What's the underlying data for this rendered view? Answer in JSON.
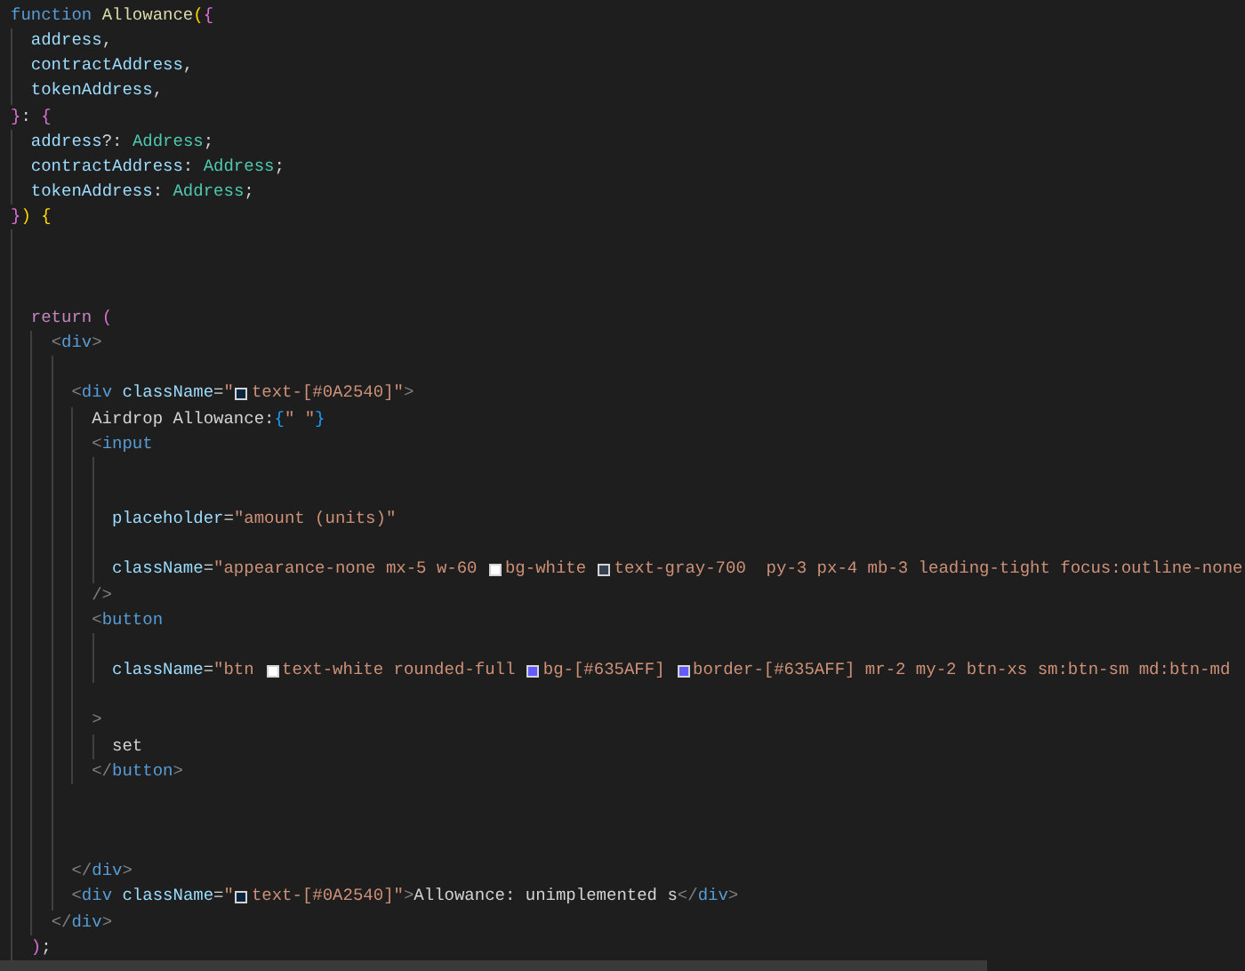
{
  "editor": {
    "lines": [
      {
        "kind": "code",
        "tokens": [
          {
            "kind": "storage",
            "text": "function "
          },
          {
            "kind": "func",
            "text": "Allowance"
          },
          {
            "kind": "b1",
            "text": "("
          },
          {
            "kind": "b2",
            "text": "{"
          }
        ]
      },
      {
        "kind": "code",
        "tokens": [
          {
            "kind": "var",
            "text": "  address"
          },
          {
            "kind": "punct",
            "text": ","
          }
        ]
      },
      {
        "kind": "code",
        "tokens": [
          {
            "kind": "var",
            "text": "  contractAddress"
          },
          {
            "kind": "punct",
            "text": ","
          }
        ]
      },
      {
        "kind": "code",
        "tokens": [
          {
            "kind": "var",
            "text": "  tokenAddress"
          },
          {
            "kind": "punct",
            "text": ","
          }
        ]
      },
      {
        "kind": "code",
        "tokens": [
          {
            "kind": "b2",
            "text": "}"
          },
          {
            "kind": "punct",
            "text": ": "
          },
          {
            "kind": "b2",
            "text": "{"
          }
        ]
      },
      {
        "kind": "code",
        "tokens": [
          {
            "kind": "var",
            "text": "  address"
          },
          {
            "kind": "punct",
            "text": "?: "
          },
          {
            "kind": "type",
            "text": "Address"
          },
          {
            "kind": "punct",
            "text": ";"
          }
        ]
      },
      {
        "kind": "code",
        "tokens": [
          {
            "kind": "var",
            "text": "  contractAddress"
          },
          {
            "kind": "punct",
            "text": ": "
          },
          {
            "kind": "type",
            "text": "Address"
          },
          {
            "kind": "punct",
            "text": ";"
          }
        ]
      },
      {
        "kind": "code",
        "tokens": [
          {
            "kind": "var",
            "text": "  tokenAddress"
          },
          {
            "kind": "punct",
            "text": ": "
          },
          {
            "kind": "type",
            "text": "Address"
          },
          {
            "kind": "punct",
            "text": ";"
          }
        ]
      },
      {
        "kind": "code",
        "tokens": [
          {
            "kind": "b2",
            "text": "}"
          },
          {
            "kind": "b1",
            "text": ")"
          },
          {
            "kind": "b1",
            "text": " {"
          }
        ]
      },
      {
        "kind": "blank"
      },
      {
        "kind": "blank"
      },
      {
        "kind": "blank"
      },
      {
        "kind": "code",
        "tokens": [
          {
            "kind": "control",
            "text": "  return "
          },
          {
            "kind": "b2",
            "text": "("
          }
        ]
      },
      {
        "kind": "code",
        "tokens": [
          {
            "kind": "tagpunct",
            "text": "    <"
          },
          {
            "kind": "tag",
            "text": "div"
          },
          {
            "kind": "tagpunct",
            "text": ">"
          }
        ]
      },
      {
        "kind": "blank"
      },
      {
        "kind": "code",
        "tokens": [
          {
            "kind": "tagpunct",
            "text": "      <"
          },
          {
            "kind": "tag",
            "text": "div"
          },
          {
            "kind": "attr",
            "text": " className"
          },
          {
            "kind": "punct",
            "text": "="
          },
          {
            "kind": "string",
            "text": "\""
          },
          {
            "kind": "swatch",
            "color": "#0a2540"
          },
          {
            "kind": "string",
            "text": "text-[#0A2540]\""
          },
          {
            "kind": "tagpunct",
            "text": ">"
          }
        ]
      },
      {
        "kind": "code",
        "tokens": [
          {
            "kind": "text",
            "text": "        Airdrop Allowance:"
          },
          {
            "kind": "b3",
            "text": "{"
          },
          {
            "kind": "string",
            "text": "\" \""
          },
          {
            "kind": "b3",
            "text": "}"
          }
        ]
      },
      {
        "kind": "code",
        "tokens": [
          {
            "kind": "tagpunct",
            "text": "        <"
          },
          {
            "kind": "tag",
            "text": "input"
          }
        ]
      },
      {
        "kind": "blank"
      },
      {
        "kind": "blank"
      },
      {
        "kind": "code",
        "tokens": [
          {
            "kind": "attr",
            "text": "          placeholder"
          },
          {
            "kind": "punct",
            "text": "="
          },
          {
            "kind": "string",
            "text": "\"amount (units)\""
          }
        ]
      },
      {
        "kind": "blank"
      },
      {
        "kind": "code",
        "tokens": [
          {
            "kind": "attr",
            "text": "          className"
          },
          {
            "kind": "punct",
            "text": "="
          },
          {
            "kind": "string",
            "text": "\"appearance-none mx-5 w-60 "
          },
          {
            "kind": "swatch",
            "color": "#ffffff"
          },
          {
            "kind": "string",
            "text": "bg-white "
          },
          {
            "kind": "swatch",
            "color": "#374151"
          },
          {
            "kind": "string",
            "text": "text-gray-700  py-3 px-4 mb-3 leading-tight focus:outline-none"
          }
        ]
      },
      {
        "kind": "code",
        "tokens": [
          {
            "kind": "tagpunct",
            "text": "        />"
          }
        ]
      },
      {
        "kind": "code",
        "tokens": [
          {
            "kind": "tagpunct",
            "text": "        <"
          },
          {
            "kind": "tag",
            "text": "button"
          }
        ]
      },
      {
        "kind": "blank"
      },
      {
        "kind": "code",
        "tokens": [
          {
            "kind": "attr",
            "text": "          className"
          },
          {
            "kind": "punct",
            "text": "="
          },
          {
            "kind": "string",
            "text": "\"btn "
          },
          {
            "kind": "swatch",
            "color": "#ffffff"
          },
          {
            "kind": "string",
            "text": "text-white rounded-full "
          },
          {
            "kind": "swatch",
            "color": "#635aff"
          },
          {
            "kind": "string",
            "text": "bg-[#635AFF] "
          },
          {
            "kind": "swatch",
            "color": "#635aff"
          },
          {
            "kind": "string",
            "text": "border-[#635AFF] mr-2 my-2 btn-xs sm:btn-sm md:btn-md"
          }
        ]
      },
      {
        "kind": "blank"
      },
      {
        "kind": "code",
        "tokens": [
          {
            "kind": "tagpunct",
            "text": "        >"
          }
        ]
      },
      {
        "kind": "code",
        "tokens": [
          {
            "kind": "text",
            "text": "          set"
          }
        ]
      },
      {
        "kind": "code",
        "tokens": [
          {
            "kind": "tagpunct",
            "text": "        </"
          },
          {
            "kind": "tag",
            "text": "button"
          },
          {
            "kind": "tagpunct",
            "text": ">"
          }
        ]
      },
      {
        "kind": "blank"
      },
      {
        "kind": "blank"
      },
      {
        "kind": "blank"
      },
      {
        "kind": "code",
        "tokens": [
          {
            "kind": "tagpunct",
            "text": "      </"
          },
          {
            "kind": "tag",
            "text": "div"
          },
          {
            "kind": "tagpunct",
            "text": ">"
          }
        ]
      },
      {
        "kind": "code",
        "tokens": [
          {
            "kind": "tagpunct",
            "text": "      <"
          },
          {
            "kind": "tag",
            "text": "div"
          },
          {
            "kind": "attr",
            "text": " className"
          },
          {
            "kind": "punct",
            "text": "="
          },
          {
            "kind": "string",
            "text": "\""
          },
          {
            "kind": "swatch",
            "color": "#0a2540"
          },
          {
            "kind": "string",
            "text": "text-[#0A2540]\""
          },
          {
            "kind": "tagpunct",
            "text": ">"
          },
          {
            "kind": "text",
            "text": "Allowance: unimplemented s"
          },
          {
            "kind": "tagpunct",
            "text": "</"
          },
          {
            "kind": "tag",
            "text": "div"
          },
          {
            "kind": "tagpunct",
            "text": ">"
          }
        ]
      },
      {
        "kind": "code",
        "tokens": [
          {
            "kind": "tagpunct",
            "text": "    </"
          },
          {
            "kind": "tag",
            "text": "div"
          },
          {
            "kind": "tagpunct",
            "text": ">"
          }
        ]
      },
      {
        "kind": "code",
        "tokens": [
          {
            "kind": "b2",
            "text": "  )"
          },
          {
            "kind": "punct",
            "text": ";"
          }
        ]
      }
    ]
  }
}
